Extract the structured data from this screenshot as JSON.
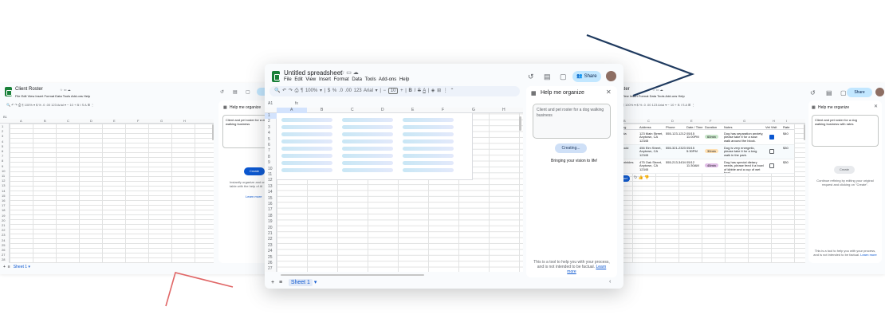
{
  "left_window": {
    "title": "Client Roster",
    "menu": [
      "File",
      "Edit",
      "View",
      "Insert",
      "Format",
      "Data",
      "Tools",
      "Add-ons",
      "Help"
    ],
    "toolbar": {
      "zoom": "100%",
      "font": "Arial",
      "font_size": "10"
    },
    "name_box": "B1",
    "columns": [
      "A",
      "B",
      "C",
      "D",
      "E",
      "F",
      "G",
      "H"
    ],
    "rows": [
      "1",
      "2",
      "3",
      "4",
      "5",
      "6",
      "7",
      "8",
      "9",
      "10",
      "11",
      "12",
      "13",
      "14",
      "15",
      "16",
      "17",
      "18",
      "19",
      "20",
      "21",
      "22",
      "23",
      "24",
      "25",
      "26",
      "27",
      "28"
    ],
    "sheet_tab": "Sheet 1",
    "panel": {
      "title": "Help me organize",
      "prompt": "Client and pet roster for a dog walking business",
      "button": "Create",
      "hint": "Instantly organize and create a table with the help of AI",
      "learn_more": "Learn more"
    }
  },
  "center_window": {
    "title": "Untitled spreadsheet",
    "menu": [
      "File",
      "Edit",
      "View",
      "Insert",
      "Format",
      "Data",
      "Tools",
      "Add-ons",
      "Help"
    ],
    "toolbar": {
      "zoom": "100%",
      "font": "Arial",
      "font_size": "10",
      "number_format": "123"
    },
    "share_label": "Share",
    "name_box": "A1",
    "fx": "fx",
    "columns": [
      "A",
      "B",
      "C",
      "D",
      "E",
      "F",
      "G",
      "H",
      "I"
    ],
    "rows": [
      "1",
      "2",
      "3",
      "4",
      "5",
      "6",
      "7",
      "8",
      "9",
      "10",
      "11",
      "12",
      "13",
      "14",
      "15",
      "16",
      "17",
      "18",
      "19",
      "20",
      "21",
      "22",
      "23",
      "24",
      "25",
      "26",
      "27"
    ],
    "sheet_tab": "Sheet 1",
    "panel": {
      "title": "Help me organize",
      "prompt": "Client and pet roster for a dog walking business",
      "status": "Creating...",
      "subtext": "Bringing your vision to life!",
      "footer": "This is a tool to help you with your process, and is not intended to be factual.",
      "learn_more": "Learn more"
    }
  },
  "right_window": {
    "title": "Roster",
    "menu": [
      "File",
      "Edit",
      "View",
      "Insert",
      "Format",
      "Data",
      "Tools",
      "Add-ons",
      "Help"
    ],
    "share_label": "Share",
    "columns": [
      "B",
      "C",
      "D",
      "E",
      "F",
      "G",
      "H",
      "I"
    ],
    "table_headers": [
      "Dog",
      "Address",
      "Phone",
      "Date / Time",
      "Duration",
      "Notes",
      "Vet Visit",
      "Rate"
    ],
    "table_rows": [
      {
        "dog": "Lola",
        "address": "123 Main Street, Anytown, CA 12345",
        "phone": "555-123-1212",
        "date": "05/15 11:00PM",
        "duration": "60min",
        "notes": "Dog has separation anxiety, please take it for a slow walk around the block.",
        "vet": true,
        "rate": "$40"
      },
      {
        "dog": "Mocki",
        "address": "456 Elm Street, Anytown, CA 12345",
        "phone": "555-321-2323",
        "date": "05/15 5:30PM",
        "duration": "30min",
        "notes": "Dog is very energetic, please take it for a long walk in the park.",
        "vet": false,
        "rate": "$30"
      },
      {
        "dog": "Sprinkles",
        "address": "475 Oak Street, Anytown, CA 12345",
        "phone": "555-213-3434",
        "date": "05/12 11:30AM",
        "duration": "45min",
        "notes": "Dog has special dietary needs, please feed it a bowl of kibble and a cup of wet food.",
        "vet": false,
        "rate": "$30"
      }
    ],
    "insert_chip": "Insert",
    "panel": {
      "title": "Help me organize",
      "prompt": "Client and pet roster for a dog walking business with rates",
      "button": "Create",
      "hint": "Continue refining by editing your original request and clicking on \"Create\".",
      "footer": "This is a tool to help you with your process, and is not intended to be factual.",
      "learn_more": "Learn more"
    }
  },
  "colors": {
    "accent": "#0b57d0",
    "sheets_green": "#188038",
    "arrow_navy": "#1f3a5f",
    "arrow_red": "#e06666",
    "share_bg": "#c2e7ff"
  }
}
